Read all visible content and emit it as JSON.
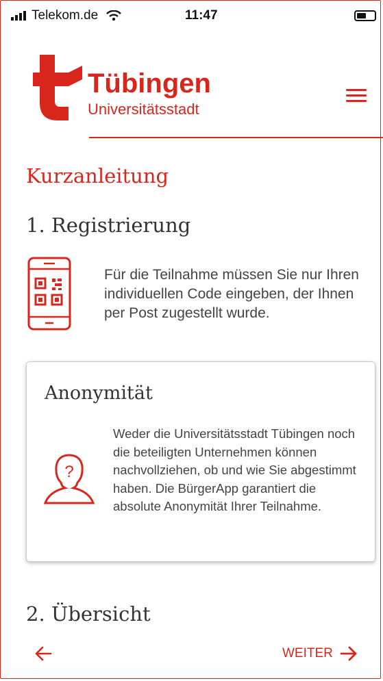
{
  "status_bar": {
    "carrier": "Telekom.de",
    "time": "11:47"
  },
  "header": {
    "brand_name": "Tübingen",
    "brand_sub": "Universitätsstadt",
    "logo_letter": "t"
  },
  "main": {
    "title": "Kurzanleitung",
    "section1_title": "1. Registrierung",
    "section1_text": "Für die Teilnahme müssen Sie nur Ihren individuellen Code eingeben, der Ihnen per Post zugestellt wurde.",
    "card": {
      "title": "Anonymität",
      "text": "Weder die Universitätsstadt Tübingen noch die beteiligten Unternehmen können nachvollziehen, ob und wie Sie abgestimmt haben. Die BürgerApp garantiert die absolute Anonymität Ihrer Teilnahme."
    },
    "section2_title": "2. Übersicht"
  },
  "nav": {
    "next_label": "WEITER"
  },
  "colors": {
    "accent": "#d9261c"
  }
}
